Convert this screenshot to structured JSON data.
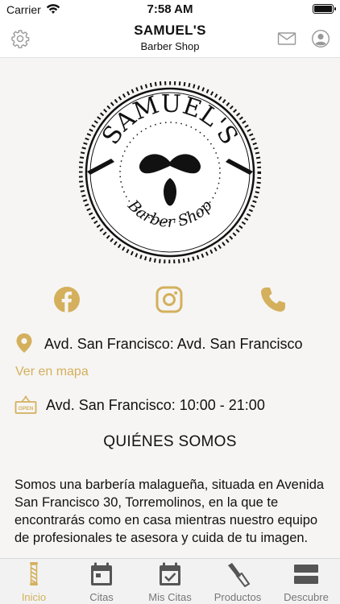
{
  "status_bar": {
    "carrier": "Carrier",
    "time": "7:58 AM"
  },
  "header": {
    "title": "SAMUEL'S",
    "subtitle": "Barber Shop"
  },
  "logo": {
    "top_text": "SAMUEL'S",
    "bottom_text": "Barber Shop"
  },
  "info": {
    "address": "Avd. San Francisco: Avd. San Francisco",
    "map_link": "Ver en mapa",
    "hours": "Avd. San Francisco: 10:00 - 21:00",
    "open_sign": "OPEN"
  },
  "about": {
    "title": "QUIÉNES SOMOS",
    "text": "Somos una barbería malagueña, situada en Avenida San Francisco 30, Torremolinos, en la que te encontrarás como en casa mientras nuestro equipo de profesionales te asesora y cuida de tu imagen."
  },
  "tabs": [
    {
      "label": "Inicio",
      "icon": "barber-pole-icon",
      "active": true
    },
    {
      "label": "Citas",
      "icon": "calendar-icon",
      "active": false
    },
    {
      "label": "Mis Citas",
      "icon": "calendar-check-icon",
      "active": false
    },
    {
      "label": "Productos",
      "icon": "razor-icon",
      "active": false
    },
    {
      "label": "Descubre",
      "icon": "menu-icon",
      "active": false
    }
  ],
  "colors": {
    "accent": "#d4b05d",
    "inactive": "#555555",
    "background": "#f6f5f3"
  }
}
